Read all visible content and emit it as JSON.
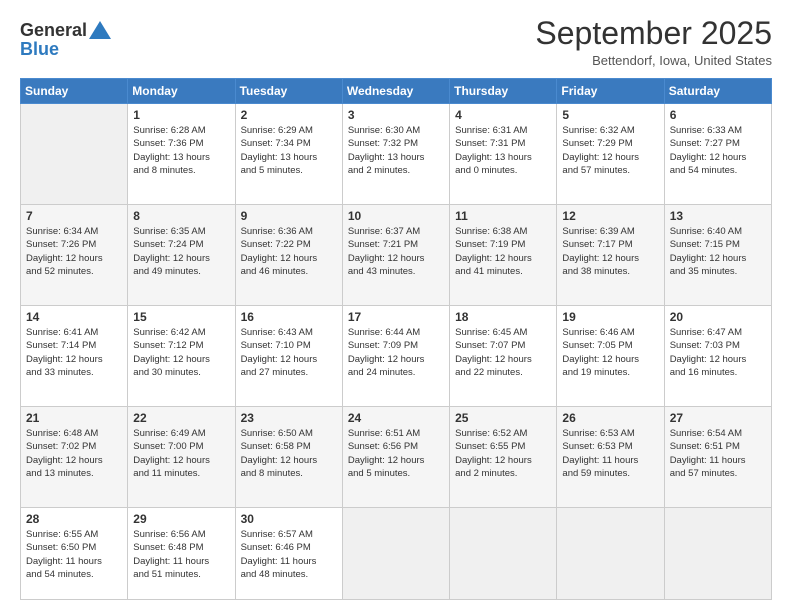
{
  "header": {
    "logo_line1": "General",
    "logo_line2": "Blue",
    "month_title": "September 2025",
    "location": "Bettendorf, Iowa, United States"
  },
  "days_of_week": [
    "Sunday",
    "Monday",
    "Tuesday",
    "Wednesday",
    "Thursday",
    "Friday",
    "Saturday"
  ],
  "weeks": [
    [
      {
        "day": "",
        "info": ""
      },
      {
        "day": "1",
        "info": "Sunrise: 6:28 AM\nSunset: 7:36 PM\nDaylight: 13 hours\nand 8 minutes."
      },
      {
        "day": "2",
        "info": "Sunrise: 6:29 AM\nSunset: 7:34 PM\nDaylight: 13 hours\nand 5 minutes."
      },
      {
        "day": "3",
        "info": "Sunrise: 6:30 AM\nSunset: 7:32 PM\nDaylight: 13 hours\nand 2 minutes."
      },
      {
        "day": "4",
        "info": "Sunrise: 6:31 AM\nSunset: 7:31 PM\nDaylight: 13 hours\nand 0 minutes."
      },
      {
        "day": "5",
        "info": "Sunrise: 6:32 AM\nSunset: 7:29 PM\nDaylight: 12 hours\nand 57 minutes."
      },
      {
        "day": "6",
        "info": "Sunrise: 6:33 AM\nSunset: 7:27 PM\nDaylight: 12 hours\nand 54 minutes."
      }
    ],
    [
      {
        "day": "7",
        "info": "Sunrise: 6:34 AM\nSunset: 7:26 PM\nDaylight: 12 hours\nand 52 minutes."
      },
      {
        "day": "8",
        "info": "Sunrise: 6:35 AM\nSunset: 7:24 PM\nDaylight: 12 hours\nand 49 minutes."
      },
      {
        "day": "9",
        "info": "Sunrise: 6:36 AM\nSunset: 7:22 PM\nDaylight: 12 hours\nand 46 minutes."
      },
      {
        "day": "10",
        "info": "Sunrise: 6:37 AM\nSunset: 7:21 PM\nDaylight: 12 hours\nand 43 minutes."
      },
      {
        "day": "11",
        "info": "Sunrise: 6:38 AM\nSunset: 7:19 PM\nDaylight: 12 hours\nand 41 minutes."
      },
      {
        "day": "12",
        "info": "Sunrise: 6:39 AM\nSunset: 7:17 PM\nDaylight: 12 hours\nand 38 minutes."
      },
      {
        "day": "13",
        "info": "Sunrise: 6:40 AM\nSunset: 7:15 PM\nDaylight: 12 hours\nand 35 minutes."
      }
    ],
    [
      {
        "day": "14",
        "info": "Sunrise: 6:41 AM\nSunset: 7:14 PM\nDaylight: 12 hours\nand 33 minutes."
      },
      {
        "day": "15",
        "info": "Sunrise: 6:42 AM\nSunset: 7:12 PM\nDaylight: 12 hours\nand 30 minutes."
      },
      {
        "day": "16",
        "info": "Sunrise: 6:43 AM\nSunset: 7:10 PM\nDaylight: 12 hours\nand 27 minutes."
      },
      {
        "day": "17",
        "info": "Sunrise: 6:44 AM\nSunset: 7:09 PM\nDaylight: 12 hours\nand 24 minutes."
      },
      {
        "day": "18",
        "info": "Sunrise: 6:45 AM\nSunset: 7:07 PM\nDaylight: 12 hours\nand 22 minutes."
      },
      {
        "day": "19",
        "info": "Sunrise: 6:46 AM\nSunset: 7:05 PM\nDaylight: 12 hours\nand 19 minutes."
      },
      {
        "day": "20",
        "info": "Sunrise: 6:47 AM\nSunset: 7:03 PM\nDaylight: 12 hours\nand 16 minutes."
      }
    ],
    [
      {
        "day": "21",
        "info": "Sunrise: 6:48 AM\nSunset: 7:02 PM\nDaylight: 12 hours\nand 13 minutes."
      },
      {
        "day": "22",
        "info": "Sunrise: 6:49 AM\nSunset: 7:00 PM\nDaylight: 12 hours\nand 11 minutes."
      },
      {
        "day": "23",
        "info": "Sunrise: 6:50 AM\nSunset: 6:58 PM\nDaylight: 12 hours\nand 8 minutes."
      },
      {
        "day": "24",
        "info": "Sunrise: 6:51 AM\nSunset: 6:56 PM\nDaylight: 12 hours\nand 5 minutes."
      },
      {
        "day": "25",
        "info": "Sunrise: 6:52 AM\nSunset: 6:55 PM\nDaylight: 12 hours\nand 2 minutes."
      },
      {
        "day": "26",
        "info": "Sunrise: 6:53 AM\nSunset: 6:53 PM\nDaylight: 11 hours\nand 59 minutes."
      },
      {
        "day": "27",
        "info": "Sunrise: 6:54 AM\nSunset: 6:51 PM\nDaylight: 11 hours\nand 57 minutes."
      }
    ],
    [
      {
        "day": "28",
        "info": "Sunrise: 6:55 AM\nSunset: 6:50 PM\nDaylight: 11 hours\nand 54 minutes."
      },
      {
        "day": "29",
        "info": "Sunrise: 6:56 AM\nSunset: 6:48 PM\nDaylight: 11 hours\nand 51 minutes."
      },
      {
        "day": "30",
        "info": "Sunrise: 6:57 AM\nSunset: 6:46 PM\nDaylight: 11 hours\nand 48 minutes."
      },
      {
        "day": "",
        "info": ""
      },
      {
        "day": "",
        "info": ""
      },
      {
        "day": "",
        "info": ""
      },
      {
        "day": "",
        "info": ""
      }
    ]
  ]
}
